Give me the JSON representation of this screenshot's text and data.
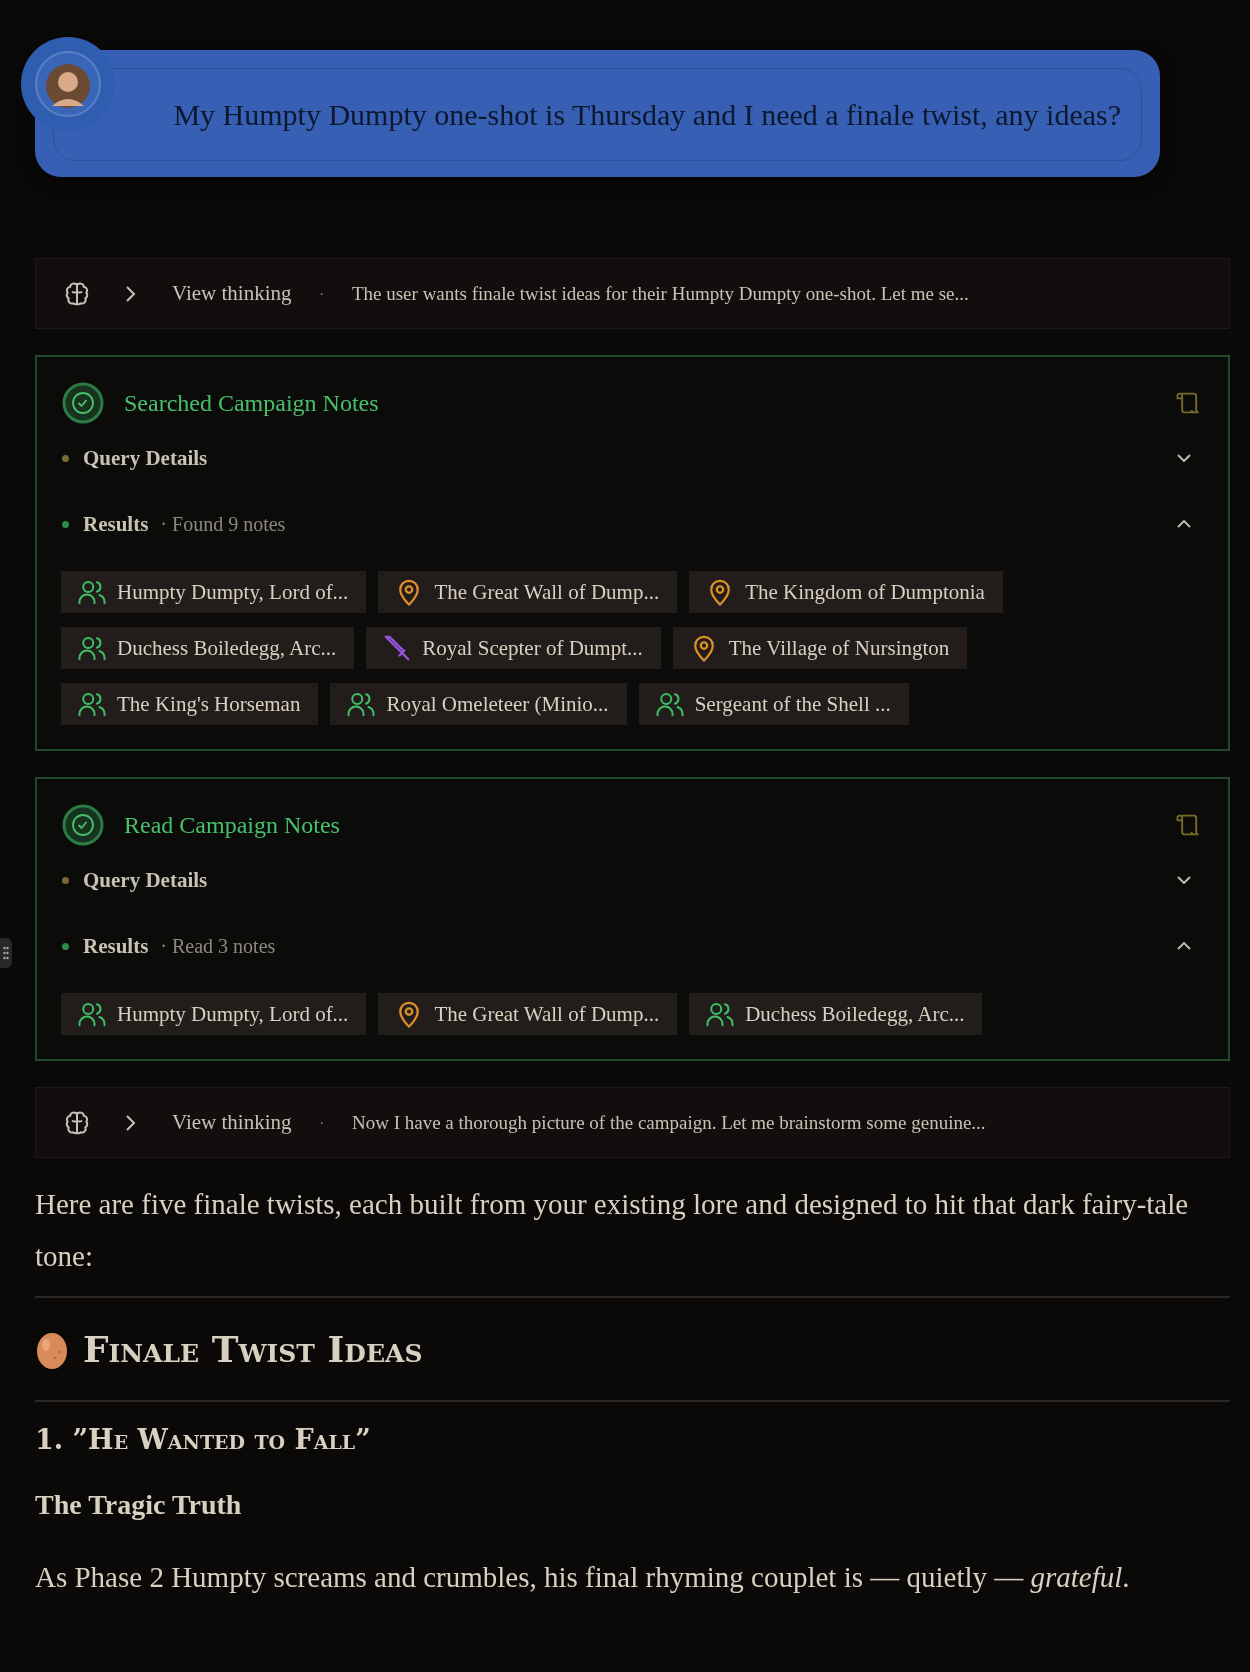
{
  "user_message": {
    "text": "My Humpty Dumpty one-shot is Thursday and I need a finale twist, any ideas?"
  },
  "transcript": [
    {
      "kind": "thinking",
      "label": "View thinking",
      "separator": "·",
      "preview": "The user wants finale twist ideas for their Humpty Dumpty one-shot. Let me se..."
    },
    {
      "kind": "tool",
      "title": "Searched Campaign Notes",
      "sections": [
        {
          "label": "Query Details",
          "expanded": false
        },
        {
          "label": "Results",
          "summary": "· Found 9 notes",
          "expanded": true
        }
      ],
      "chips": [
        {
          "kind": "character",
          "label": "Humpty Dumpty, Lord of..."
        },
        {
          "kind": "location",
          "label": "The Great Wall of Dump..."
        },
        {
          "kind": "location",
          "label": "The Kingdom of Dumptonia"
        },
        {
          "kind": "character",
          "label": "Duchess Boiledegg, Arc..."
        },
        {
          "kind": "item",
          "label": "Royal Scepter of Dumpt..."
        },
        {
          "kind": "location",
          "label": "The Village of Nursington"
        },
        {
          "kind": "character",
          "label": "The King's Horseman"
        },
        {
          "kind": "character",
          "label": "Royal Omeleteer (Minio..."
        },
        {
          "kind": "character",
          "label": "Sergeant of the Shell ..."
        }
      ]
    },
    {
      "kind": "tool",
      "title": "Read Campaign Notes",
      "sections": [
        {
          "label": "Query Details",
          "expanded": false
        },
        {
          "label": "Results",
          "summary": "· Read 3 notes",
          "expanded": true
        }
      ],
      "chips": [
        {
          "kind": "character",
          "label": "Humpty Dumpty, Lord of..."
        },
        {
          "kind": "location",
          "label": "The Great Wall of Dump..."
        },
        {
          "kind": "character",
          "label": "Duchess Boiledegg, Arc..."
        }
      ]
    },
    {
      "kind": "thinking",
      "label": "View thinking",
      "separator": "·",
      "preview": "Now I have a thorough picture of the campaign. Let me brainstorm some genuine..."
    }
  ],
  "answer": [
    {
      "kind": "paragraph",
      "text": "Here are five finale twists, each built from your existing lore and designed to hit that dark fairy-tale tone:"
    },
    {
      "kind": "rule"
    },
    {
      "kind": "heading",
      "text": "Finale Twist Ideas"
    },
    {
      "kind": "rule"
    },
    {
      "kind": "subheading",
      "text": "1. ”He Wanted to Fall”"
    },
    {
      "kind": "subsubheading",
      "text": "The Tragic Truth"
    },
    {
      "kind": "paragraph",
      "text": "As Phase 2 Humpty screams and crumbles, his final rhyming couplet is — quietly — *grateful*."
    }
  ]
}
